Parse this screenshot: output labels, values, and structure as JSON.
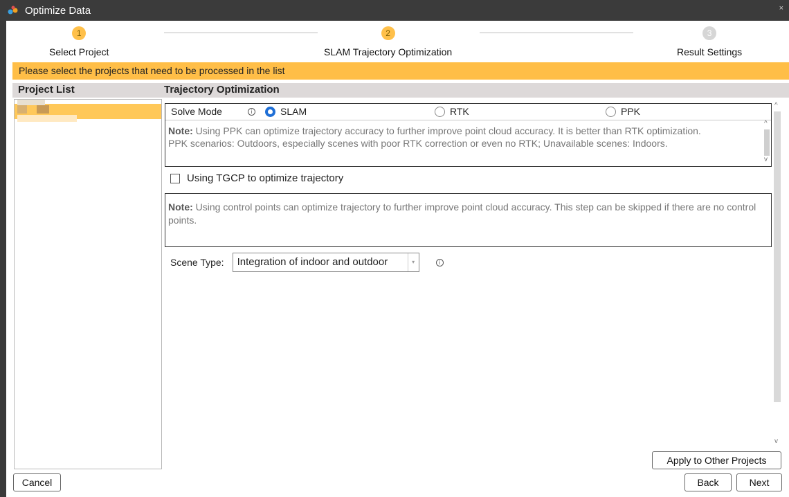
{
  "window": {
    "title": "Optimize Data",
    "close": "×"
  },
  "steps": [
    {
      "num": "1",
      "label": "Select Project",
      "state": "active"
    },
    {
      "num": "2",
      "label": "SLAM Trajectory Optimization",
      "state": "active"
    },
    {
      "num": "3",
      "label": "Result Settings",
      "state": "inactive"
    }
  ],
  "banner": "Please select the projects that need to be processed in the list",
  "headers": {
    "project_list": "Project List",
    "trajectory": "Trajectory Optimization"
  },
  "solve": {
    "label": "Solve Mode",
    "options": [
      {
        "label": "SLAM",
        "selected": true
      },
      {
        "label": "RTK",
        "selected": false
      },
      {
        "label": "PPK",
        "selected": false
      }
    ],
    "note_bold": "Note:",
    "note_text": " Using PPK can optimize trajectory accuracy to further improve point cloud accuracy. It is better than RTK optimization.",
    "note_line2": "PPK scenarios: Outdoors, especially scenes with poor RTK correction or even no RTK; Unavailable scenes: Indoors."
  },
  "tgcp": {
    "label": "Using TGCP to optimize trajectory",
    "checked": false
  },
  "note2": {
    "bold": "Note:",
    "text": " Using control points can optimize trajectory to further improve point cloud accuracy. This step can be skipped if there are no control points."
  },
  "scene": {
    "label": "Scene Type:",
    "value": "Integration of indoor and outdoor"
  },
  "buttons": {
    "apply": "Apply to Other Projects",
    "cancel": "Cancel",
    "back": "Back",
    "next": "Next"
  },
  "colors": {
    "accent": "#ffbe47",
    "radio": "#1f6fd6",
    "selection": "#ffc859"
  }
}
